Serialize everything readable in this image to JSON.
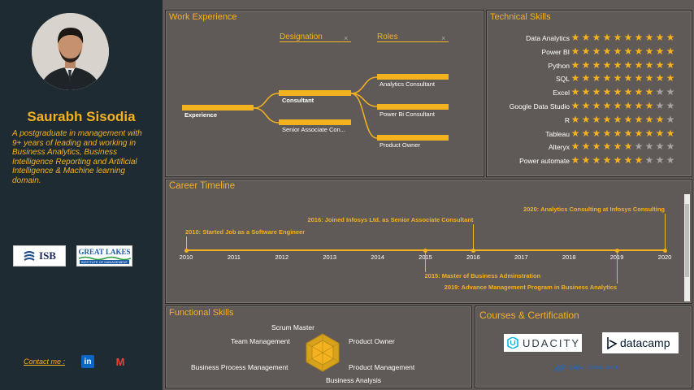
{
  "profile": {
    "name": "Saurabh Sisodia",
    "bio": "A postgraduate in management with 9+ years of leading and working in Business Analytics, Business Intelligence Reporting and Artificial Intelligence & Machine learning domain.",
    "logos": {
      "isb": "ISB",
      "great_lakes_top": "GREAT LAKES",
      "great_lakes_bottom": "INSTITUTE OF MANAGEMENT"
    },
    "contact_label": "Contact me :",
    "contact_icons": [
      "linkedin-icon",
      "gmail-icon"
    ],
    "linkedin_glyph": "in",
    "gmail_glyph": "M"
  },
  "work": {
    "title": "Work Experience",
    "col_designation": "Designation",
    "col_roles": "Roles",
    "close_glyph": "×",
    "root": "Experience",
    "designations": [
      "Consultant",
      "Senior Associate Con..."
    ],
    "roles": [
      "Analytics Consultant",
      "Power Bi Consultant",
      "Product Owner"
    ]
  },
  "skills": {
    "title": "Technical Skills",
    "max": 10,
    "items": [
      {
        "name": "Data Analytics",
        "rating": 10
      },
      {
        "name": "Power BI",
        "rating": 10
      },
      {
        "name": "Python",
        "rating": 10
      },
      {
        "name": "SQL",
        "rating": 10
      },
      {
        "name": "Excel",
        "rating": 8
      },
      {
        "name": "Google Data Studio",
        "rating": 8
      },
      {
        "name": "R",
        "rating": 9
      },
      {
        "name": "Tableau",
        "rating": 10
      },
      {
        "name": "Alteryx",
        "rating": 6
      },
      {
        "name": "Power automate",
        "rating": 7
      }
    ],
    "colors": {
      "filled": "#f5b21f",
      "empty": "#a7a3a0"
    }
  },
  "career": {
    "title": "Career Timeline",
    "years": [
      "2010",
      "2011",
      "2012",
      "2013",
      "2014",
      "2015",
      "2016",
      "2017",
      "2018",
      "2019",
      "2020"
    ],
    "events_above": [
      {
        "year": 2010,
        "text": "2010: Started Job as a Software Engineer"
      },
      {
        "year": 2016,
        "text": "2016: Joined Infosys Ltd. as Senior Associate Consultant"
      },
      {
        "year": 2020,
        "text": "2020: Analytics Consulting at Infosys Consulting"
      }
    ],
    "events_below": [
      {
        "year": 2015,
        "text": "2015: Master of Business Adminstration"
      },
      {
        "year": 2019,
        "text": "2019: Advance Management Program in Business Analytics"
      }
    ]
  },
  "functional": {
    "title": "Functional Skills",
    "labels": [
      "Scrum Master",
      "Product Owner",
      "Product Management",
      "Business Analysis",
      "Business Process Management",
      "Team Management"
    ]
  },
  "courses": {
    "title": "Courses & Certification",
    "udacity": "UDACITY",
    "datacamp": "datacamp",
    "safe": "SAFe",
    "scaled": "SCALED AGILE"
  }
}
